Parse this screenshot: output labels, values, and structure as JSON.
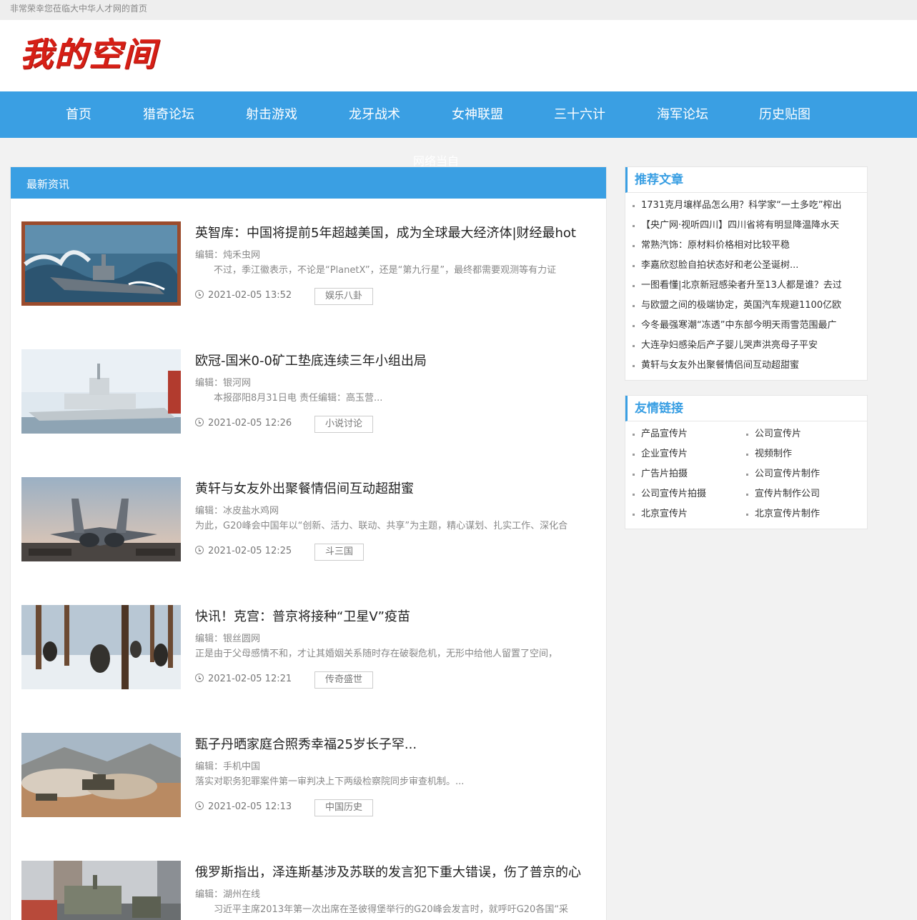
{
  "topbar": {
    "welcome": "非常荣幸您莅临大中华人才网的首页"
  },
  "header": {
    "logo_text": "我的空间"
  },
  "nav": {
    "items": [
      {
        "label": "首页"
      },
      {
        "label": "猎奇论坛"
      },
      {
        "label": "射击游戏"
      },
      {
        "label": "龙牙战术"
      },
      {
        "label": "女神联盟"
      },
      {
        "label": "三十六计"
      },
      {
        "label": "海军论坛"
      },
      {
        "label": "历史贴图"
      }
    ]
  },
  "ghost_text": "网络当自",
  "main": {
    "heading": "最新资讯",
    "articles": [
      {
        "title": "英智库：中国将提前5年超越美国，成为全球最大经济体|财经最hot",
        "editor": "编辑：炖禾虫网",
        "summary": "　　不过，季江徽表示，不论是“PlanetX”，还是“第九行星”，最终都需要观测等有力证",
        "date": "2021-02-05 13:52",
        "tag": "娱乐八卦",
        "image": "warship-painting"
      },
      {
        "title": "欧冠-国米0-0矿工垫底连续三年小组出局",
        "editor": "编辑：银河网",
        "summary": "　　本报邵阳8月31日电 责任编辑：高玉营...",
        "date": "2021-02-05 12:26",
        "tag": "小说讨论",
        "image": "navy-ship"
      },
      {
        "title": "黄轩与女友外出聚餐情侣间互动超甜蜜",
        "editor": "编辑：冰皮盐水鸡网",
        "summary": "为此，G20峰会中国年以“创新、活力、联动、共享”为主题，精心谋划、扎实工作、深化合",
        "date": "2021-02-05 12:25",
        "tag": "斗三国",
        "image": "fighter-jet"
      },
      {
        "title": "快讯！克宫：普京将接种“卫星V”疫苗",
        "editor": "编辑：银丝圆网",
        "summary": "正是由于父母感情不和，才让其婚姻关系随时存在破裂危机，无形中给他人留置了空间，",
        "date": "2021-02-05 12:21",
        "tag": "传奇盛世",
        "image": "soldiers-snow"
      },
      {
        "title": "甄子丹晒家庭合照秀幸福25岁长子罕...",
        "editor": "编辑：手机中国",
        "summary": "落实对职务犯罪案件第一审判决上下两级检察院同步审查机制。...",
        "date": "2021-02-05 12:13",
        "tag": "中国历史",
        "image": "tank-dust"
      },
      {
        "title": "俄罗斯指出，泽连斯基涉及苏联的发言犯下重大错误，伤了普京的心",
        "editor": "编辑：湖州在线",
        "summary": "　　习近平主席2013年第一次出席在圣彼得堡举行的G20峰会发言时，就呼吁G20各国“采",
        "date": "",
        "tag": "",
        "image": "military-parade"
      }
    ]
  },
  "sidebar": {
    "recommended": {
      "heading": "推荐文章",
      "items": [
        "1731克月壤样品怎么用？科学家“一土多吃”榨出",
        "【央广网·视听四川】四川省将有明显降温降水天",
        "常熟汽饰：原材料价格相对比较平稳",
        "李嘉欣怼脸自拍状态好和老公圣诞树...",
        "一图看懂|北京新冠感染者升至13人都是谁？去过",
        "与欧盟之间的极端协定，英国汽车规避1100亿欧",
        "今冬最强寒潮“冻透”中东部今明天雨雪范围最广",
        "大连孕妇感染后产子婴儿哭声洪亮母子平安",
        "黄轩与女友外出聚餐情侣间互动超甜蜜"
      ]
    },
    "links": {
      "heading": "友情链接",
      "items": [
        "产品宣传片",
        "公司宣传片",
        "企业宣传片",
        "视频制作",
        "广告片拍摄",
        "公司宣传片制作",
        "公司宣传片拍摄",
        "宣传片制作公司",
        "北京宣传片",
        "北京宣传片制作"
      ]
    }
  }
}
